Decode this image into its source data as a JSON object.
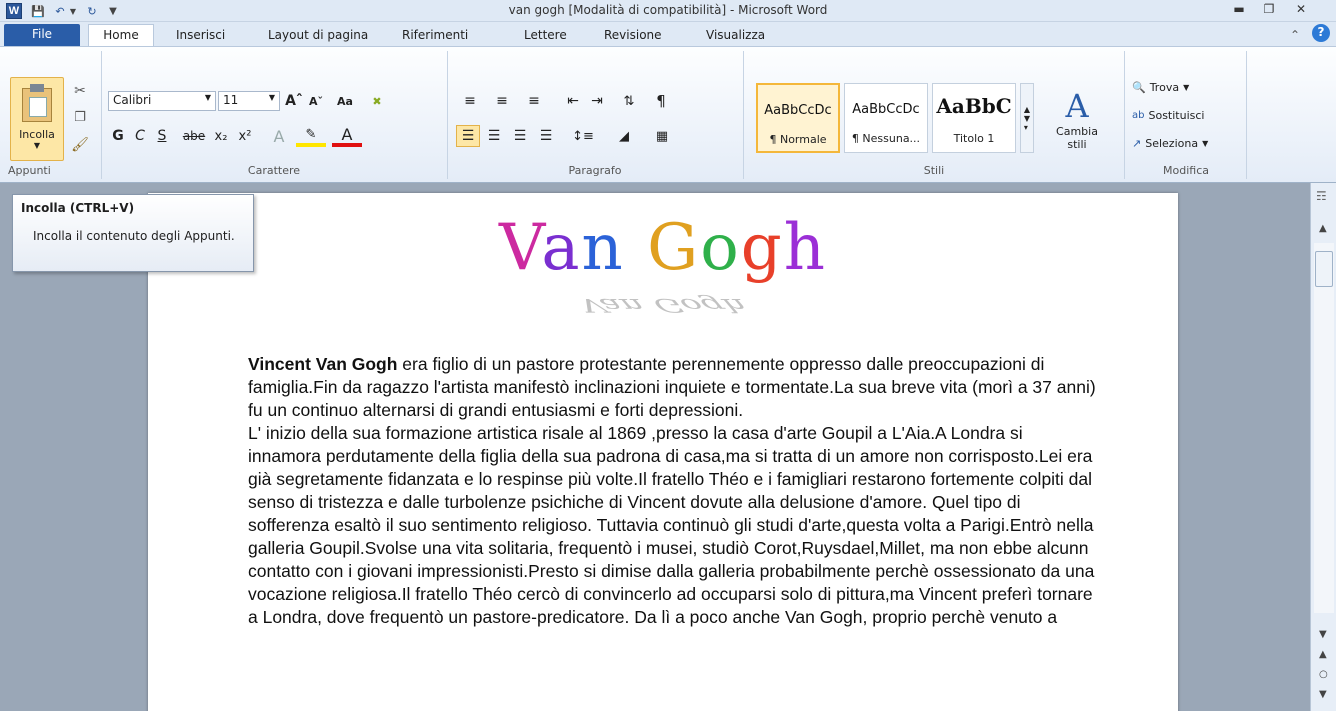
{
  "window": {
    "title": "van gogh [Modalità di compatibilità] - Microsoft Word"
  },
  "tabs": [
    "File",
    "Home",
    "Inserisci",
    "Layout di pagina",
    "Riferimenti",
    "Lettere",
    "Revisione",
    "Visualizza"
  ],
  "clipboard": {
    "paste_label": "Incolla",
    "group_label": "Appunti"
  },
  "font": {
    "family": "Calibri",
    "size": "11",
    "group_label": "Carattere",
    "bold": "G",
    "italic": "C",
    "underline": "S",
    "strike": "abe",
    "case": "Aa"
  },
  "paragraph": {
    "group_label": "Paragrafo"
  },
  "styles": {
    "group_label": "Stili",
    "items": [
      {
        "sample": "AaBbCcDc",
        "name": "¶ Normale"
      },
      {
        "sample": "AaBbCcDc",
        "name": "¶ Nessuna..."
      },
      {
        "sample": "AaBbC",
        "name": "Titolo 1"
      }
    ],
    "change_label": "Cambia stili"
  },
  "editing": {
    "group_label": "Modifica",
    "find": "Trova",
    "replace": "Sostituisci",
    "select": "Seleziona"
  },
  "tooltip": {
    "title": "Incolla (CTRL+V)",
    "body": "Incolla il contenuto degli Appunti."
  },
  "document": {
    "title_art": "Van Gogh",
    "title_colors": [
      "#cc2aa0",
      "#7a2fd0",
      "#2b62d8",
      "#e0a020",
      "#2fb04a",
      "#e8402a",
      "#9b2fd6"
    ],
    "lead_name": "Vincent Van Gogh",
    "para1": " era figlio di un pastore protestante perennemente oppresso dalle preoccupazioni di famiglia.Fin da ragazzo l'artista manifestò inclinazioni inquiete e tormentate.La sua breve vita (morì a 37 anni) fu un continuo alternarsi di grandi entusiasmi e forti depressioni.",
    "para2": "L' inizio della sua formazione artistica risale al 1869 ,presso la casa d'arte Goupil a L'Aia.A Londra si innamora perdutamente della figlia della sua padrona di casa,ma si tratta di un amore non corrisposto.Lei era già segretamente fidanzata e lo respinse più volte.Il fratello Théo e i famigliari restarono fortemente colpiti dal senso di tristezza e dalle turbolenze psichiche di Vincent dovute alla delusione d'amore. Quel tipo di sofferenza esaltò il suo sentimento religioso. Tuttavia continuò gli studi d'arte,questa volta a Parigi.Entrò nella galleria Goupil.Svolse una vita solitaria, frequentò i musei, studiò Corot,Ruysdael,Millet, ma non ebbe alcunn contatto con i giovani impressionisti.Presto si dimise dalla galleria probabilmente perchè ossessionato da una vocazione religiosa.Il fratello Théo cercò di convincerlo ad occuparsi solo di pittura,ma Vincent preferì tornare a Londra, dove frequentò un pastore-predicatore. Da lì a poco anche Van Gogh, proprio perchè venuto a"
  }
}
